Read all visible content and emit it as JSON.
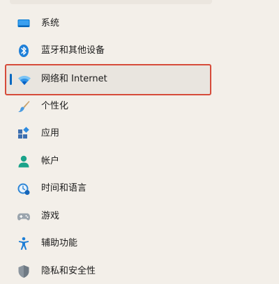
{
  "sidebar": {
    "items": [
      {
        "label": "系统",
        "icon": "system-icon",
        "selected": false
      },
      {
        "label": "蓝牙和其他设备",
        "icon": "bluetooth-icon",
        "selected": false
      },
      {
        "label": "网络和 Internet",
        "icon": "wifi-icon",
        "selected": true
      },
      {
        "label": "个性化",
        "icon": "personalization-brush-icon",
        "selected": false
      },
      {
        "label": "应用",
        "icon": "apps-icon",
        "selected": false
      },
      {
        "label": "帐户",
        "icon": "account-person-icon",
        "selected": false
      },
      {
        "label": "时间和语言",
        "icon": "time-language-globe-icon",
        "selected": false
      },
      {
        "label": "游戏",
        "icon": "gamepad-icon",
        "selected": false
      },
      {
        "label": "辅助功能",
        "icon": "accessibility-icon",
        "selected": false
      },
      {
        "label": "隐私和安全性",
        "icon": "shield-icon",
        "selected": false
      }
    ]
  },
  "colors": {
    "background": "#f3efe9",
    "accent": "#0067c0",
    "highlight_border": "#d64b3a",
    "selected_background": "#e9e5df"
  }
}
